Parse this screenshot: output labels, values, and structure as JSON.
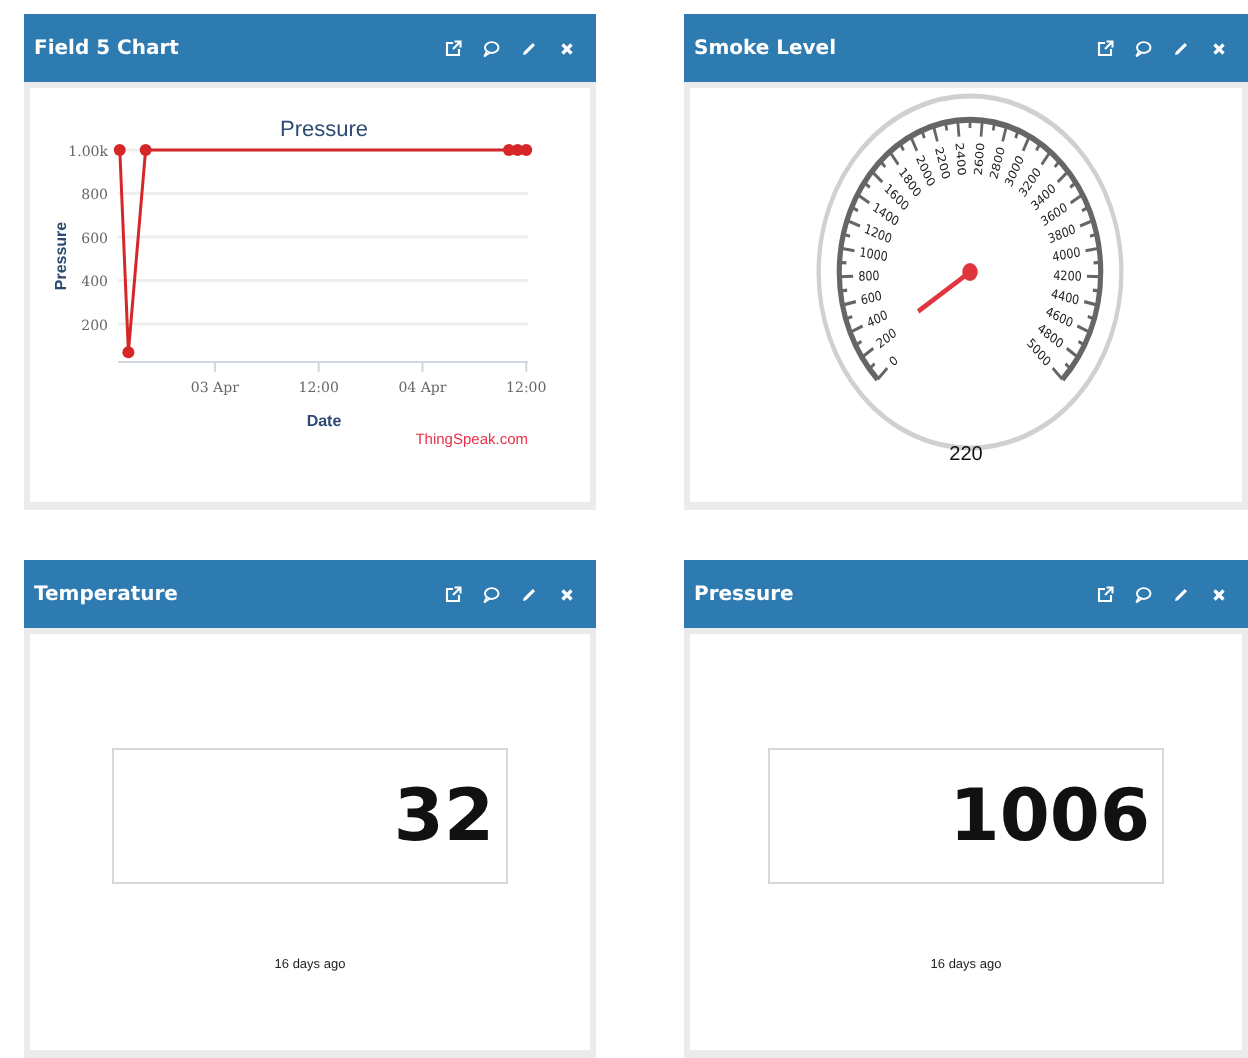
{
  "widgets": [
    {
      "kind": "chart",
      "title": "Field 5 Chart",
      "credit": "ThingSpeak.com",
      "chart_data": {
        "type": "line",
        "title": "Pressure",
        "xlabel": "Date",
        "ylabel": "Pressure",
        "categories": [
          null,
          null,
          null,
          null,
          null,
          null,
          null,
          null,
          null,
          null,
          null,
          "03 Apr",
          null,
          null,
          null,
          null,
          null,
          null,
          null,
          null,
          null,
          null,
          null,
          "12:00",
          null,
          null,
          null,
          null,
          null,
          null,
          null,
          null,
          null,
          null,
          null,
          "04 Apr",
          null,
          null,
          null,
          null,
          null,
          null,
          null,
          null,
          null,
          null,
          null,
          "12:00"
        ],
        "grid": true,
        "series": [
          {
            "color": "#d62728",
            "marker": true,
            "values": [
              1000,
              70,
              null,
              1000,
              null,
              null,
              null,
              null,
              null,
              null,
              null,
              null,
              null,
              null,
              null,
              null,
              null,
              null,
              null,
              null,
              null,
              null,
              null,
              null,
              null,
              null,
              null,
              null,
              null,
              null,
              null,
              null,
              null,
              null,
              null,
              null,
              null,
              null,
              null,
              null,
              null,
              null,
              null,
              null,
              null,
              1000,
              1000,
              1000
            ]
          }
        ],
        "ylim": [
          25,
          1000
        ],
        "yticks": [
          {
            "value": 200,
            "label": "200"
          },
          {
            "value": 400,
            "label": "400"
          },
          {
            "value": 600,
            "label": "600"
          },
          {
            "value": 800,
            "label": "800"
          },
          {
            "value": 1000,
            "label": "1.00k"
          }
        ]
      }
    },
    {
      "kind": "gauge",
      "title": "Smoke Level",
      "value": "220",
      "labels": [
        "0",
        "200",
        "400",
        "600",
        "800",
        "1000",
        "1200",
        "1400",
        "1600",
        "1800",
        "2000",
        "2200",
        "2400",
        "2600",
        "2800",
        "3000",
        "3200",
        "3400",
        "3600",
        "3800",
        "4000",
        "4200",
        "4400",
        "4600",
        "4800",
        "5000"
      ]
    },
    {
      "kind": "numeric",
      "title": "Temperature",
      "value": "32",
      "age": "16 days ago"
    },
    {
      "kind": "numeric",
      "title": "Pressure",
      "value": "1006",
      "age": "16 days ago"
    }
  ]
}
